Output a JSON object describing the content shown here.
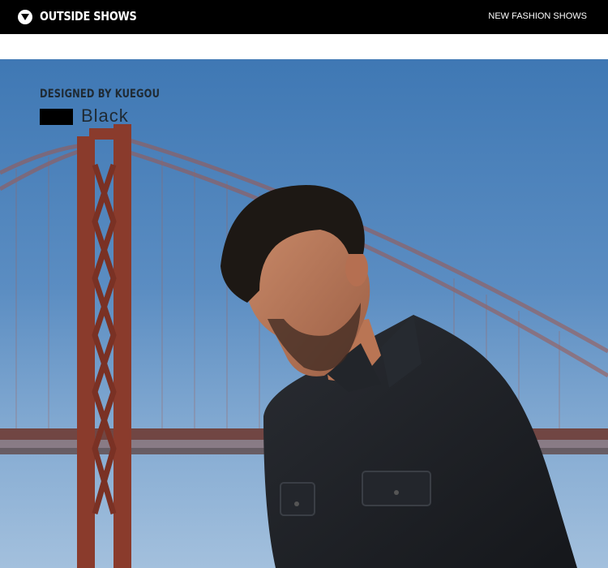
{
  "header": {
    "badge_icon": "chevron-down-icon",
    "title": "OUTSIDE SHOWS",
    "right_link": "NEW FASHION SHOWS"
  },
  "hero": {
    "designed_by": "DESIGNED BY KUEGOU",
    "color_swatch_hex": "#000000",
    "color_name": "Black",
    "image_subject": "photo of a man in a black denim shirt in front of a red suspension bridge"
  },
  "colors": {
    "topbar_bg": "#000000",
    "sky": "#5b8dc2",
    "bridge": "#8a3b2c"
  }
}
